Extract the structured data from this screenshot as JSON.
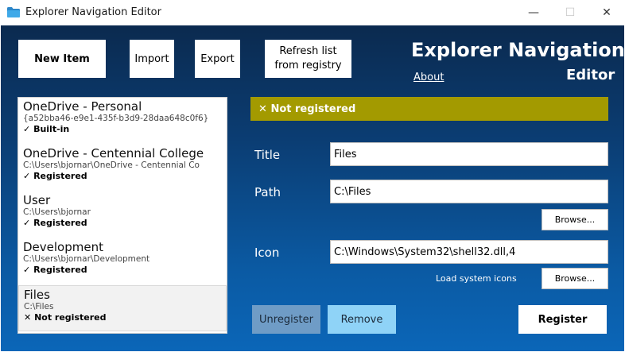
{
  "window": {
    "title": "Explorer Navigation Editor",
    "controls": {
      "minimize": "—",
      "maximize": "☐",
      "close": "✕"
    }
  },
  "toolbar": {
    "new_item": "New Item",
    "import": "Import",
    "export": "Export",
    "refresh_line1": "Refresh list",
    "refresh_line2": "from registry"
  },
  "header": {
    "title_line1": "Explorer Navigation",
    "title_line2": "Editor",
    "about": "About"
  },
  "list": {
    "items": [
      {
        "title": "OneDrive - Personal",
        "subtitle": "{a52bba46-e9e1-435f-b3d9-28daa648c0f6}",
        "status_icon": "✓",
        "status": "Built-in"
      },
      {
        "title": "OneDrive - Centennial College",
        "subtitle": "C:\\Users\\bjornar\\OneDrive - Centennial Co",
        "status_icon": "✓",
        "status": "Registered"
      },
      {
        "title": "User",
        "subtitle": "C:\\Users\\bjornar",
        "status_icon": "✓",
        "status": "Registered"
      },
      {
        "title": "Development",
        "subtitle": "C:\\Users\\bjornar\\Development",
        "status_icon": "✓",
        "status": "Registered"
      },
      {
        "title": "Files",
        "subtitle": "C:\\Files",
        "status_icon": "✕",
        "status": "Not registered"
      }
    ]
  },
  "banner": {
    "icon": "✕",
    "text": "Not registered",
    "color": "#a39a00"
  },
  "form": {
    "title_label": "Title",
    "title_value": "Files",
    "path_label": "Path",
    "path_value": "C:\\Files",
    "path_browse": "Browse...",
    "icon_label": "Icon",
    "icon_value": "C:\\Windows\\System32\\shell32.dll,4",
    "load_system_icons": "Load system icons",
    "icon_browse": "Browse..."
  },
  "actions": {
    "unregister": "Unregister",
    "remove": "Remove",
    "register": "Register"
  },
  "colors": {
    "background_top": "#0b2a4f",
    "background_bottom": "#0b66b8",
    "unregister_bg": "#6f9cc6",
    "remove_bg": "#8fd3f7"
  }
}
